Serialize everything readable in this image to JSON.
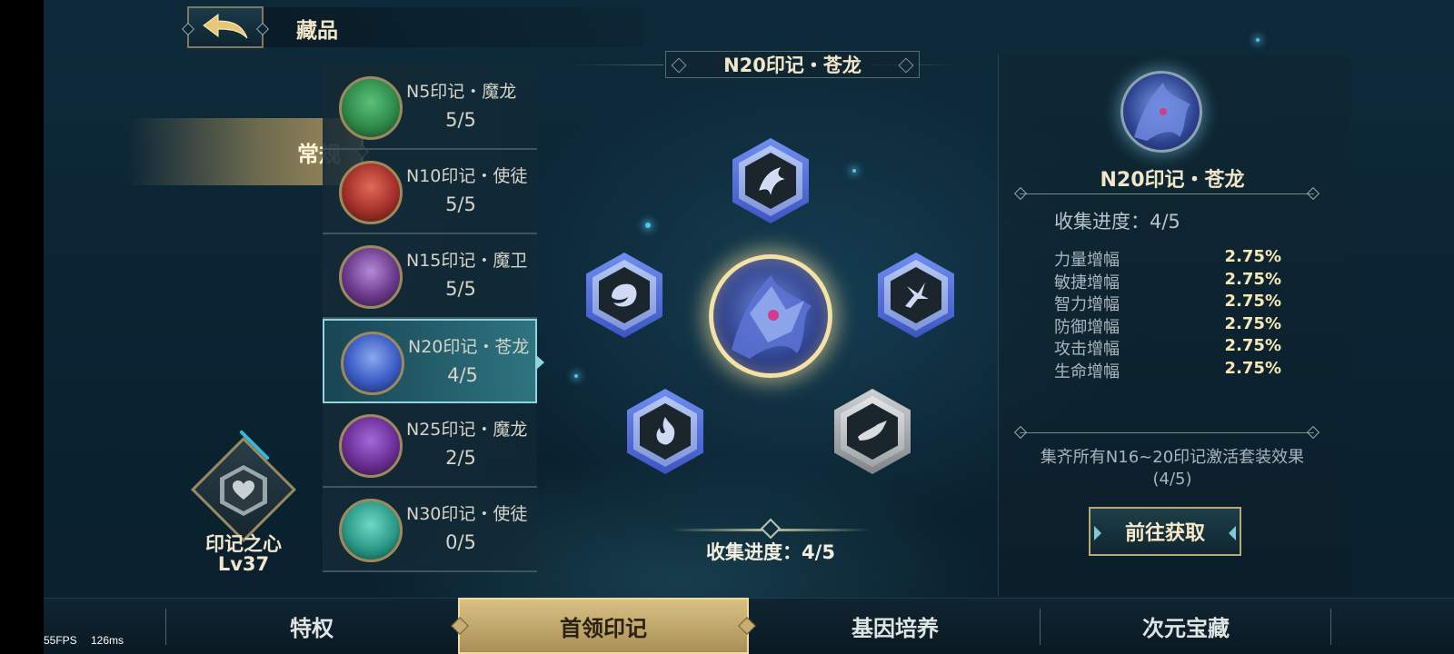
{
  "header": {
    "title": "藏品",
    "back_icon": "back-arrow-icon"
  },
  "category": {
    "active_label": "常规"
  },
  "heart": {
    "title": "印记之心",
    "level": "Lv37",
    "icon": "heart-icon"
  },
  "marks": [
    {
      "name": "N5印记・魔龙",
      "count": "5/5",
      "color": "#2f8a4a"
    },
    {
      "name": "N10印记・使徒",
      "count": "5/5",
      "color": "#a4302a"
    },
    {
      "name": "N15印记・魔卫",
      "count": "5/5",
      "color": "#6a3a8c"
    },
    {
      "name": "N20印记・苍龙",
      "count": "4/5",
      "color": "#3a5cc4",
      "selected": true
    },
    {
      "name": "N25印记・魔龙",
      "count": "2/5",
      "color": "#6b2e96"
    },
    {
      "name": "N30印记・使徒",
      "count": "0/5",
      "color": "#2c9a88"
    }
  ],
  "center": {
    "title": "N20印记・苍龙",
    "progress_text": "收集进度：4/5",
    "slots": [
      {
        "name": "slot-top",
        "state": "collected",
        "icon": "dragon-head-icon"
      },
      {
        "name": "slot-left",
        "state": "collected",
        "icon": "dragon-body-icon"
      },
      {
        "name": "slot-right",
        "state": "collected",
        "icon": "dragon-claw-icon"
      },
      {
        "name": "slot-bottom-left",
        "state": "collected",
        "icon": "dragon-flame-icon"
      },
      {
        "name": "slot-bottom-right",
        "state": "missing",
        "icon": "dragon-tail-icon"
      }
    ]
  },
  "info": {
    "name": "N20印记・苍龙",
    "progress_text": "收集进度：4/5",
    "stats": [
      {
        "name": "力量增幅",
        "value": "2.75%"
      },
      {
        "name": "敏捷增幅",
        "value": "2.75%"
      },
      {
        "name": "智力增幅",
        "value": "2.75%"
      },
      {
        "name": "防御增幅",
        "value": "2.75%"
      },
      {
        "name": "攻击增幅",
        "value": "2.75%"
      },
      {
        "name": "生命增幅",
        "value": "2.75%"
      }
    ],
    "set_effect_line1": "集齐所有N16~20印记激活套装效果",
    "set_effect_line2": "(4/5)",
    "goto_button": "前往获取"
  },
  "bottom_nav": {
    "tabs": [
      "特权",
      "首领印记",
      "基因培养",
      "次元宝藏"
    ],
    "active_index": 1
  },
  "debug": {
    "fps": "55FPS",
    "latency": "126ms"
  }
}
